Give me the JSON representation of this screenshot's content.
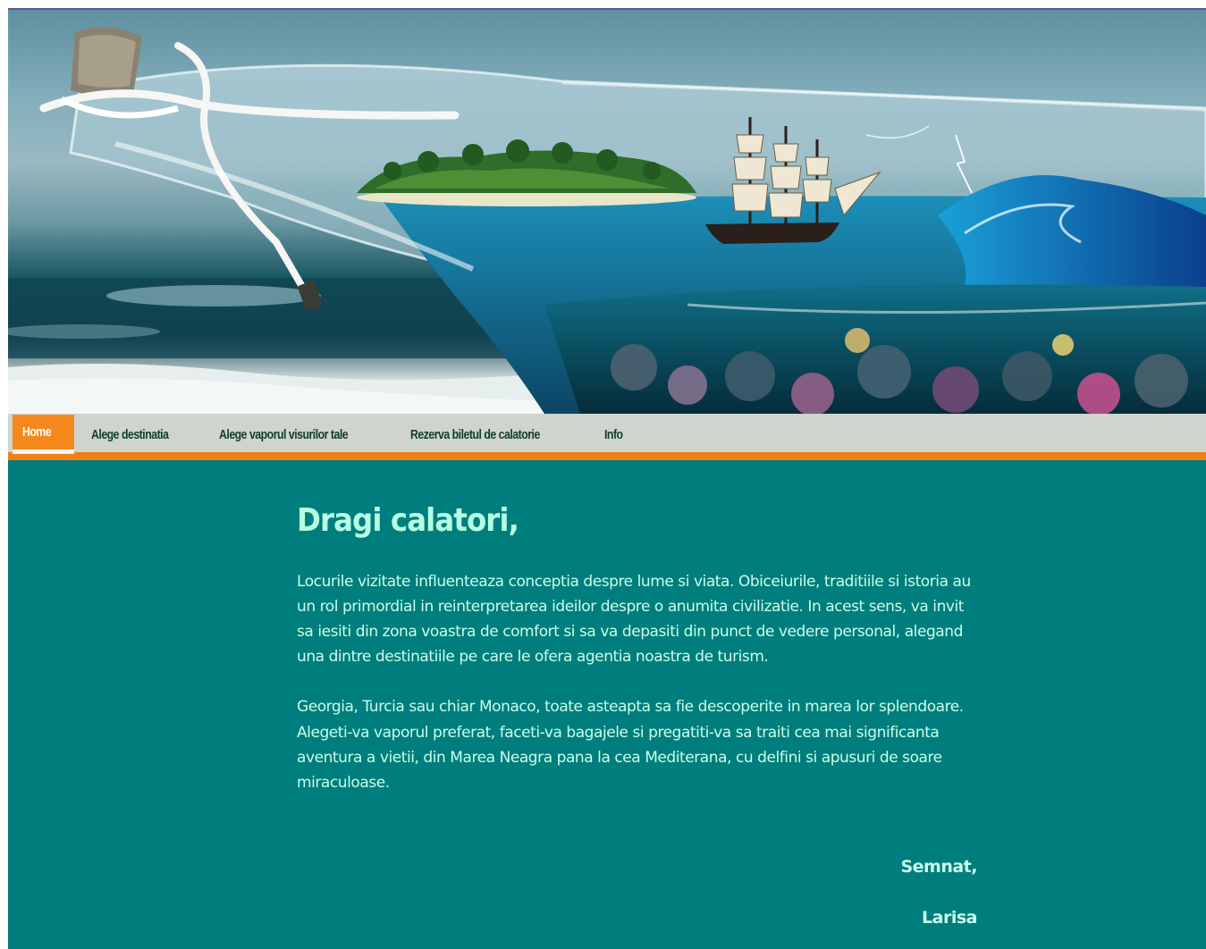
{
  "nav": {
    "items": [
      {
        "label": "Home"
      },
      {
        "label": "Alege destinatia"
      },
      {
        "label": "Alege vaporul visurilor tale"
      },
      {
        "label": "Rezerva biletul de calatorie"
      },
      {
        "label": "Info"
      }
    ]
  },
  "main": {
    "greeting": "Dragi calatori,",
    "paragraphs": [
      "Locurile vizitate influenteaza conceptia despre lume si viata. Obiceiurile, traditiile si istoria au un rol primordial in reinterpretarea ideilor despre o anumita civilizatie. In acest sens, va invit sa iesiti din zona voastra de comfort si sa va depasiti din punct de vedere personal, alegand una dintre destinatiile pe care le ofera agentia noastra de turism.",
      "Georgia, Turcia sau chiar Monaco, toate asteapta sa fie descoperite in marea lor splendoare. Alegeti-va vaporul preferat, faceti-va bagajele si pregatiti-va sa traiti cea mai significanta aventura a vietii, din Marea Neagra pana la cea Mediterana, cu delfini si apusuri de soare miraculoase."
    ],
    "signature": {
      "closing": "Semnat,",
      "name": "Larisa"
    }
  },
  "colors": {
    "background": "#007d7d",
    "nav_bar": "#cfd4cd",
    "accent": "#f5881c",
    "text": "#c8ffe9"
  },
  "icons": {
    "hero": "bottle-ship-island-banner"
  }
}
